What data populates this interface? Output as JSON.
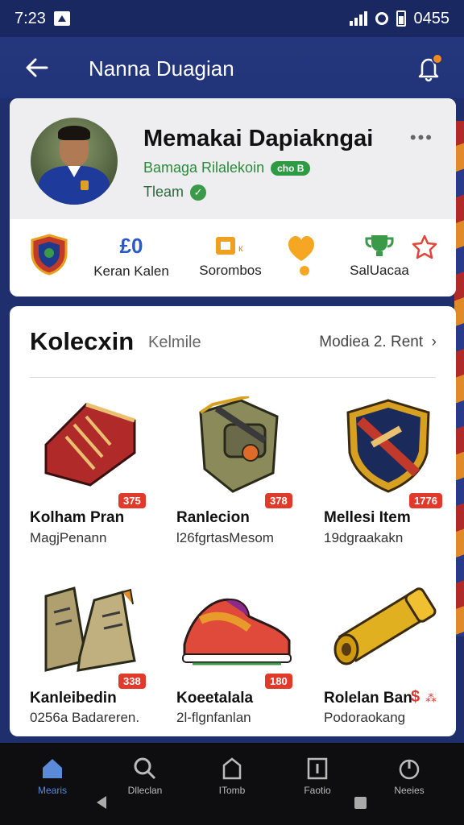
{
  "status_bar": {
    "time": "7:23",
    "right_text": "0455"
  },
  "header": {
    "title": "Nanna Duagian"
  },
  "profile": {
    "name": "Memakai Dapiakngai",
    "subtitle": "Bamaga Rilalekoin",
    "pill": "cho B",
    "team": "Tleam"
  },
  "stats": [
    {
      "label": "",
      "icon": "club-shield-icon"
    },
    {
      "value": "£0",
      "label": "Keran Kalen",
      "icon": "coin-icon"
    },
    {
      "label": "Sorombos",
      "icon": "card-icon"
    },
    {
      "label": "",
      "icon": "heart-medal-icon"
    },
    {
      "label": "SalUacaa",
      "icon": "trophy-icon"
    },
    {
      "label": "",
      "icon": "star-icon"
    }
  ],
  "collection": {
    "title": "Kolecxin",
    "subtitle": "Kelmile",
    "link": "Modiea 2. Rent",
    "items": [
      {
        "name": "Kolham Pran",
        "desc": "MagjPenann",
        "price": "375",
        "icon": "jersey-bag-icon"
      },
      {
        "name": "Ranlecion",
        "desc": "l26fgrtasMesom",
        "price": "378",
        "icon": "gear-bag-icon"
      },
      {
        "name": "Mellesi Item",
        "desc": "19dgraakakn",
        "price": "1776",
        "icon": "club-crest-icon"
      },
      {
        "name": "Kanleibedin",
        "desc": "0256a Badareren.",
        "price": "338",
        "icon": "boots-icon"
      },
      {
        "name": "Koeetalala",
        "desc": "2l-flgnfanlan",
        "price": "180",
        "icon": "sneaker-icon"
      },
      {
        "name": "Rolelan Ban",
        "desc": "Podoraokang",
        "price": "",
        "icon": "golden-cannon-icon"
      }
    ]
  },
  "nav": [
    {
      "label": "Mearis",
      "icon": "home-icon",
      "active": true
    },
    {
      "label": "Dlleclan",
      "icon": "search-icon",
      "active": false
    },
    {
      "label": "ITomb",
      "icon": "shop-icon",
      "active": false
    },
    {
      "label": "Faotio",
      "icon": "info-icon",
      "active": false
    },
    {
      "label": "Neeies",
      "icon": "power-icon",
      "active": false
    }
  ],
  "colors": {
    "header": "#223479",
    "accent_green": "#2e9a44",
    "price_red": "#e23a2a",
    "nav_active": "#5a8ad8"
  }
}
